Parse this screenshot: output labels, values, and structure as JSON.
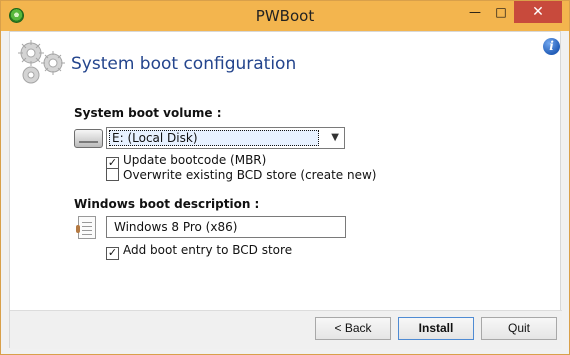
{
  "window": {
    "title": "PWBoot",
    "minimize": "—",
    "maximize": "□",
    "close": "✕"
  },
  "header": {
    "title": "System boot configuration"
  },
  "icons": {
    "app": "app-icon",
    "gears": "gears-icon",
    "info": "i",
    "drive": "drive-icon",
    "note": "document-icon"
  },
  "boot_volume": {
    "label": "System boot volume :",
    "selected": "E: (Local Disk)",
    "options": [
      "E: (Local Disk)"
    ],
    "update_bootcode": {
      "label": "Update bootcode (MBR)",
      "checked": true
    },
    "overwrite_bcd": {
      "label": "Overwrite existing BCD store (create new)",
      "checked": false
    }
  },
  "windows_boot": {
    "label": "Windows boot description :",
    "value": "Windows 8 Pro (x86)",
    "add_entry": {
      "label": "Add boot entry to BCD store",
      "checked": true
    }
  },
  "buttons": {
    "back": "< Back",
    "install": "Install",
    "quit": "Quit"
  }
}
